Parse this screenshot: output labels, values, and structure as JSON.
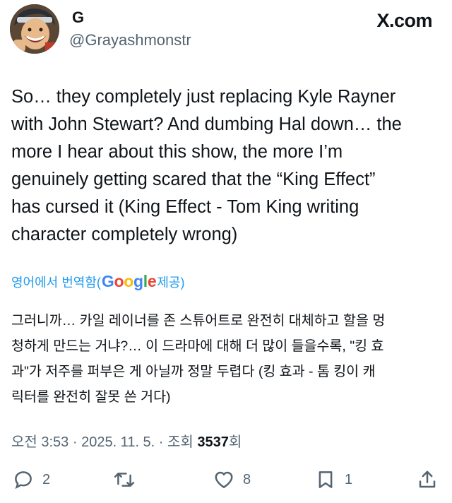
{
  "header": {
    "display_name": "G",
    "handle": "@Grayashmonstr",
    "site_label": "X.com"
  },
  "tweet": {
    "text": "So… they completely just replacing Kyle Rayner\nwith John Stewart? And dumbing Hal down… the\nmore I hear about this show, the more I’m\ngenuinely getting scared that the “King Effect”\nhas cursed it (King Effect - Tom King writing\ncharacter completely wrong)"
  },
  "translation": {
    "label_prefix": "영어에서 번역함(",
    "provider": "Google",
    "label_suffix": " 제공)",
    "text": "그러니까… 카일 레이너를 존 스튜어트로 완전히 대체하고 할을 멍\n청하게 만드는 거냐?… 이 드라마에 대해 더 많이 들을수록, \"킹 효\n과\"가 저주를 퍼부은 게 아닐까 정말 두렵다 (킹 효과 - 톰 킹이 캐\n릭터를 완전히 잘못 쓴 거다)"
  },
  "meta": {
    "time": "오전 3:53",
    "sep1": " · ",
    "date": "2025. 11. 5.",
    "sep2": " · ",
    "views_label": "조회 ",
    "views_count": "3537",
    "views_suffix": "회"
  },
  "actions": {
    "reply_count": "2",
    "retweet_count": "",
    "like_count": "8",
    "bookmark_count": "1"
  },
  "colors": {
    "text": "#0f1419",
    "secondary": "#536471",
    "link": "#1d9bf0"
  }
}
